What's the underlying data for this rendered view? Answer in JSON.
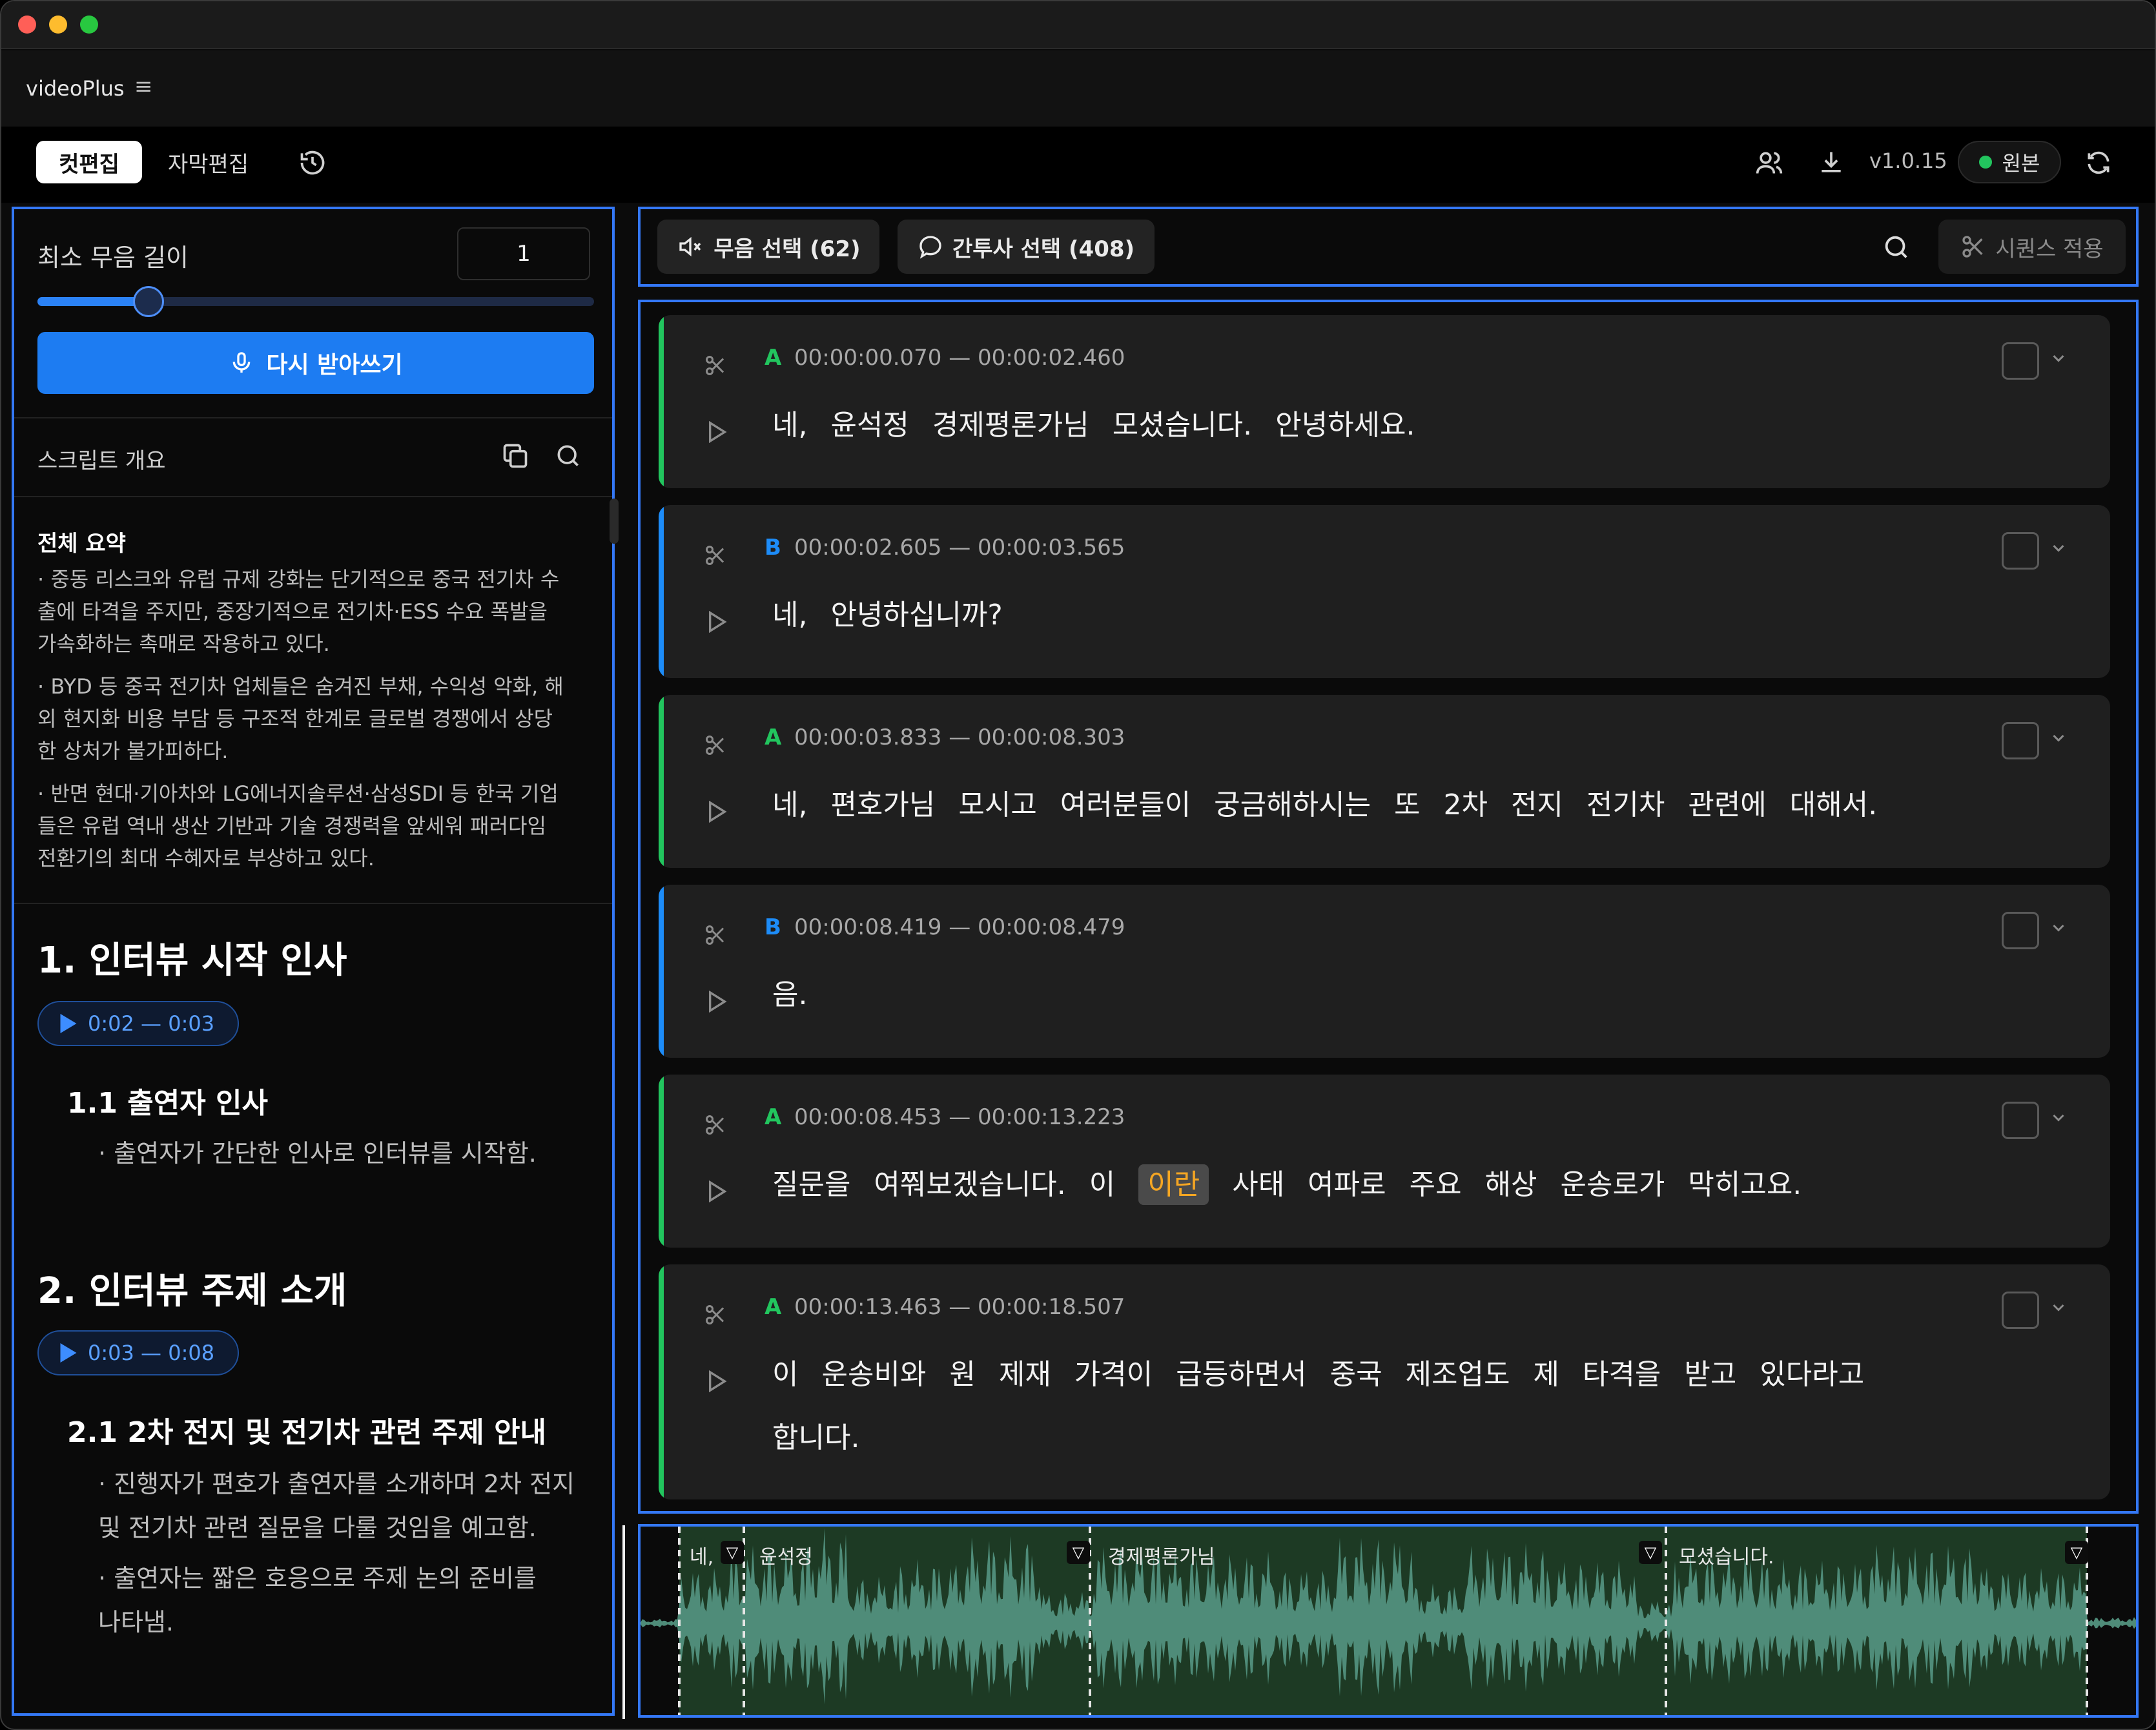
{
  "app": {
    "name": "videoPlus"
  },
  "tabs": {
    "active": "컷편집",
    "other": "자막편집"
  },
  "header": {
    "version": "v1.0.15",
    "mode": "원본"
  },
  "left": {
    "min_silence_label": "최소 무음 길이",
    "min_silence_value": "1",
    "slider_level": 0.2,
    "retranscribe": "다시 받아쓰기",
    "outline_title": "스크립트 개요",
    "summary_title": "전체 요약",
    "summary": [
      {
        "l1": "· 중동 리스크와 유럽 규제 강화는 단기적으로 중국 전기차 수",
        "l2": "출에 타격을 주지만, 중장기적으로 전기차·ESS 수요 폭발을",
        "l3": "가속화하는 촉매로 작용하고 있다."
      },
      {
        "l1": "· BYD 등 중국 전기차 업체들은 숨겨진 부채, 수익성 악화, 해",
        "l2": "외 현지화 비용 부담 등 구조적 한계로 글로벌 경쟁에서 상당",
        "l3": "한 상처가 불가피하다."
      },
      {
        "l1": "· 반면 현대·기아차와 LG에너지솔루션·삼성SDI 등 한국 기업",
        "l2": "들은 유럽 역내 생산 기반과 기술 경쟁력을 앞세워 패러다임",
        "l3": "전환기의 최대 수혜자로 부상하고 있다."
      }
    ],
    "sections": [
      {
        "title": "1.  인터뷰 시작 인사",
        "time": "0:02 — 0:03",
        "sub": "1.1 출연자 인사",
        "bullets": [
          "· 출연자가 간단한 인사로 인터뷰를 시작함."
        ]
      },
      {
        "title": "2.  인터뷰 주제 소개",
        "time": "0:03 — 0:08",
        "sub": "2.1 2차 전지 및 전기차 관련 주제 안내",
        "b1a": "· 진행자가 편호가 출연자를 소개하며 2차 전지",
        "b1b": "및 전기차 관련 질문을 다룰 것임을 예고함.",
        "b2a": "· 출연자는 짧은 호응으로 주제 논의 준비를",
        "b2b": "나타냄."
      }
    ]
  },
  "toolbar": {
    "silence": "무음 선택 (62)",
    "filler": "간투사 선택 (408)",
    "apply": "시퀀스 적용"
  },
  "segments": [
    {
      "speaker": "A",
      "time": "00:00:00.070 — 00:00:02.460",
      "text": "네,  윤석정  경제평론가님  모셨습니다.  안녕하세요."
    },
    {
      "speaker": "B",
      "time": "00:00:02.605 — 00:00:03.565",
      "text": "네,  안녕하십니까?"
    },
    {
      "speaker": "A",
      "time": "00:00:03.833 — 00:00:08.303",
      "text": "네,  편호가님  모시고  여러분들이  궁금해하시는  또  2차  전지  전기차  관련에  대해서."
    },
    {
      "speaker": "B",
      "time": "00:00:08.419 — 00:00:08.479",
      "text": "음."
    },
    {
      "speaker": "A",
      "time": "00:00:08.453 — 00:00:13.223",
      "pre": "질문을  여쭤보겠습니다.  이",
      "hl": "이란",
      "post": "사태  여파로  주요  해상  운송로가  막히고요."
    },
    {
      "speaker": "A",
      "time": "00:00:13.463 — 00:00:18.507",
      "text": "이  운송비와  원  제재  가격이  급등하면서  중국  제조업도  제  타격을  받고  있다라고",
      "text2": "합니다."
    }
  ],
  "colors": {
    "speaker_a": "#22c55e",
    "speaker_b": "#1d8cf8",
    "accent": "#3478f6",
    "highlight": "#f5a623"
  },
  "waveform": {
    "words": [
      "네,",
      "윤석정",
      "경제평론가님",
      "모셨습니다."
    ]
  },
  "icons": [
    "history-icon",
    "users-icon",
    "download-icon",
    "refresh-icon",
    "mute-icon",
    "chat-icon",
    "search-icon",
    "scissors-icon",
    "play-icon",
    "copy-icon",
    "mic-icon"
  ]
}
